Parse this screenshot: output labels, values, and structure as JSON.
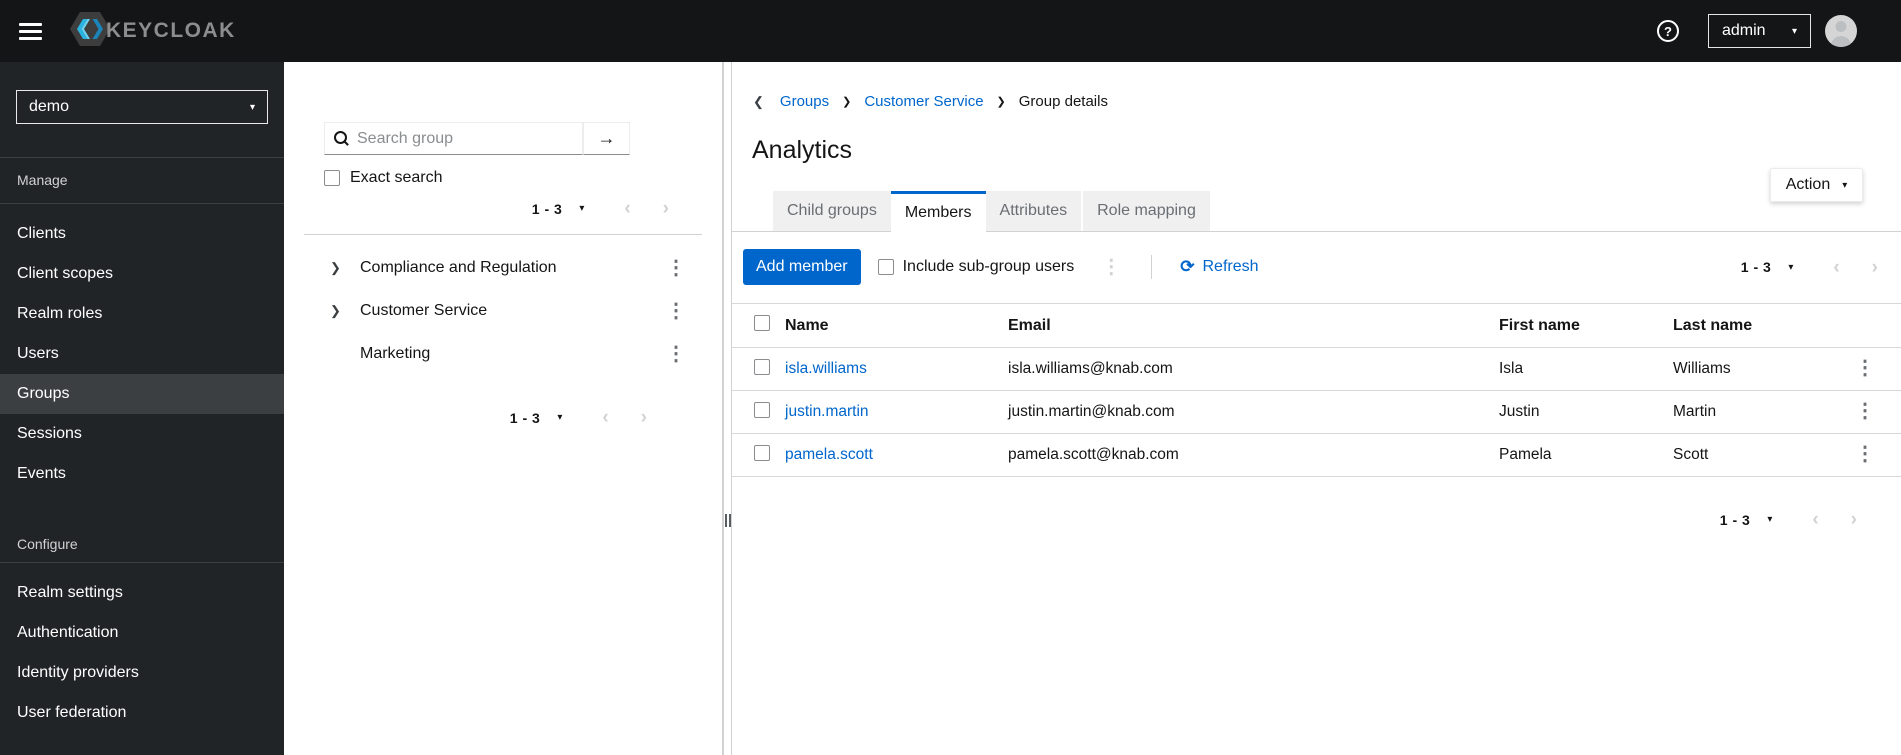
{
  "icons": {
    "help": "?",
    "caret_down": "▾",
    "arrow_right": "→",
    "chevron_left": "‹",
    "chevron_right": "›",
    "breadcrumb_back": "❮",
    "breadcrumb_sep": "❯",
    "tree_expand": "❯",
    "kebab": "⋮",
    "refresh": "⟳"
  },
  "colors": {
    "primary": "#0066cc",
    "link": "#0066cc",
    "masthead_bg": "#131517",
    "sidebar_bg": "#212427",
    "sidebar_active_bg": "#3c3f42",
    "tab_inactive_bg": "#f0f0f0",
    "border": "#d2d2d2"
  },
  "masthead": {
    "brand": "KEYCLOAK",
    "user": "admin"
  },
  "sidebar": {
    "realm": "demo",
    "active_item": "Groups",
    "sections": [
      {
        "title": "Manage",
        "items": [
          "Clients",
          "Client scopes",
          "Realm roles",
          "Users",
          "Groups",
          "Sessions",
          "Events"
        ]
      },
      {
        "title": "Configure",
        "items": [
          "Realm settings",
          "Authentication",
          "Identity providers",
          "User federation"
        ]
      }
    ]
  },
  "groups_panel": {
    "search_placeholder": "Search group",
    "exact_search": "Exact search",
    "pagination_top": "1 - 3",
    "pagination_bottom": "1 - 3",
    "groups": [
      {
        "name": "Compliance and Regulation",
        "expandable": true
      },
      {
        "name": "Customer Service",
        "expandable": true
      },
      {
        "name": "Marketing",
        "expandable": false
      }
    ]
  },
  "main": {
    "breadcrumb_items": [
      "Groups",
      "Customer Service",
      "Group details"
    ],
    "title": "Analytics",
    "action": "Action",
    "tabs": [
      "Child groups",
      "Members",
      "Attributes",
      "Role mapping"
    ],
    "active_tab": "Members",
    "toolbar": {
      "add_member": "Add member",
      "include_subgroups": "Include sub-group users",
      "refresh": "Refresh",
      "pagination": "1 - 3"
    },
    "table": {
      "headers": [
        "Name",
        "Email",
        "First name",
        "Last name"
      ],
      "rows": [
        {
          "username": "isla.williams",
          "email": "isla.williams@knab.com",
          "first_name": "Isla",
          "last_name": "Williams"
        },
        {
          "username": "justin.martin",
          "email": "justin.martin@knab.com",
          "first_name": "Justin",
          "last_name": "Martin"
        },
        {
          "username": "pamela.scott",
          "email": "pamela.scott@knab.com",
          "first_name": "Pamela",
          "last_name": "Scott"
        }
      ]
    },
    "pagination_bottom": "1 - 3"
  }
}
